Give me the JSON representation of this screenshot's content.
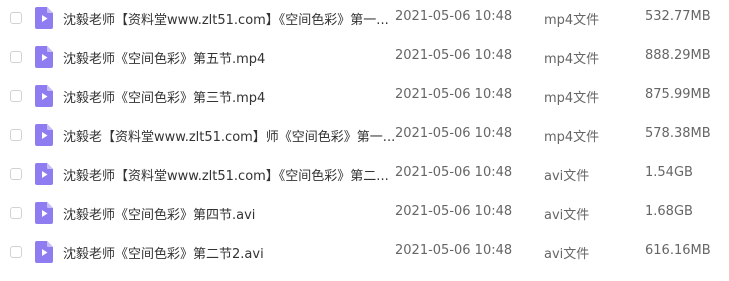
{
  "colors": {
    "icon_fill": "#8e7df0",
    "icon_fold": "#c7bdf8",
    "checkbox_border": "#d2d2d2",
    "name_text": "#333333",
    "meta_text": "#666666"
  },
  "icons": {
    "file": "video-file-icon"
  },
  "files": [
    {
      "name": "沈毅老师【资料堂www.zlt51.com】《空间色彩》第一...",
      "date": "2021-05-06 10:48",
      "type": "mp4文件",
      "size": "532.77MB"
    },
    {
      "name": "沈毅老师《空间色彩》第五节.mp4",
      "date": "2021-05-06 10:48",
      "type": "mp4文件",
      "size": "888.29MB"
    },
    {
      "name": "沈毅老师《空间色彩》第三节.mp4",
      "date": "2021-05-06 10:48",
      "type": "mp4文件",
      "size": "875.99MB"
    },
    {
      "name": "沈毅老【资料堂www.zlt51.com】师《空间色彩》第一...",
      "date": "2021-05-06 10:48",
      "type": "mp4文件",
      "size": "578.38MB"
    },
    {
      "name": "沈毅老师【资料堂www.zlt51.com】《空间色彩》第二...",
      "date": "2021-05-06 10:48",
      "type": "avi文件",
      "size": "1.54GB"
    },
    {
      "name": "沈毅老师《空间色彩》第四节.avi",
      "date": "2021-05-06 10:48",
      "type": "avi文件",
      "size": "1.68GB"
    },
    {
      "name": "沈毅老师《空间色彩》第二节2.avi",
      "date": "2021-05-06 10:48",
      "type": "avi文件",
      "size": "616.16MB"
    }
  ]
}
